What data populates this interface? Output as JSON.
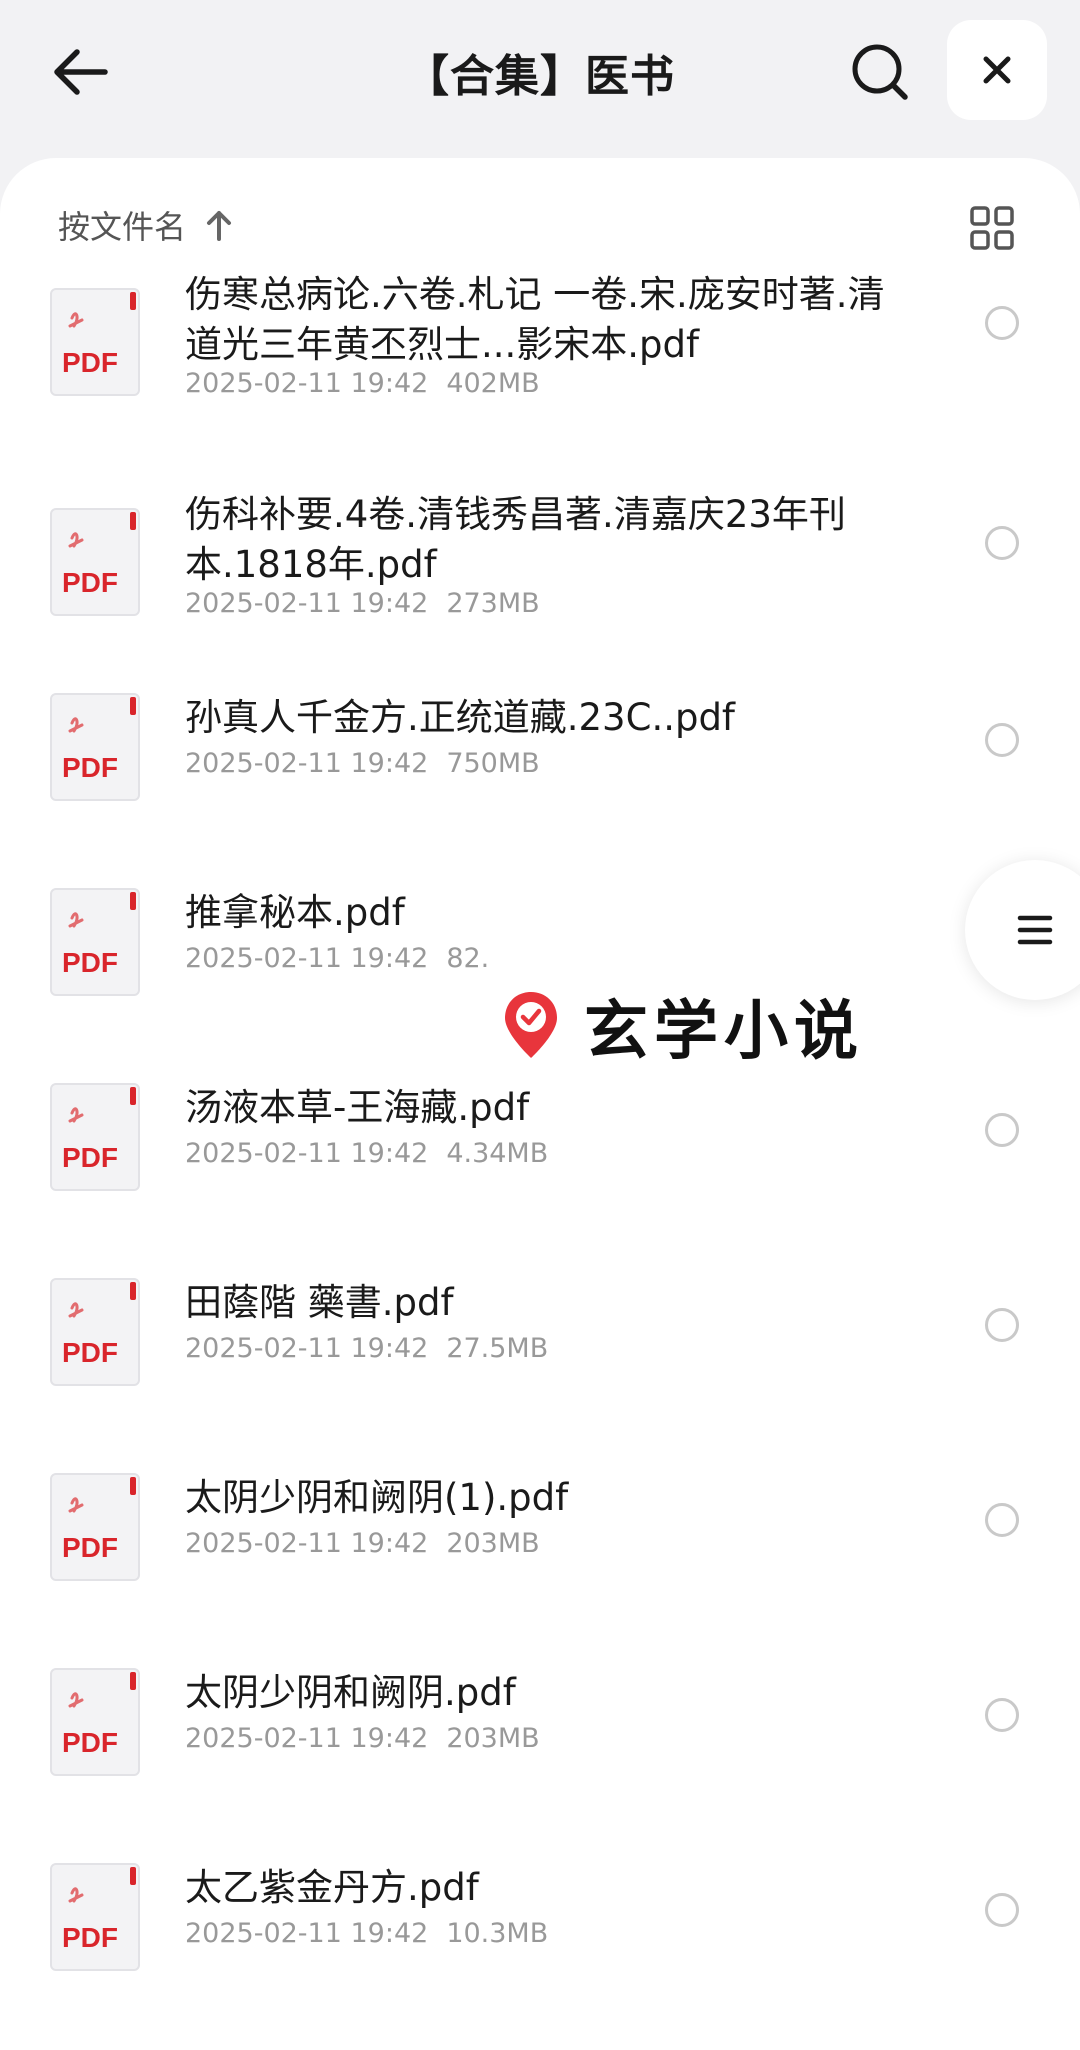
{
  "header": {
    "title": "【合集】医书"
  },
  "sort": {
    "label": "按文件名"
  },
  "files": [
    {
      "name": "伤寒总病论.六卷.札记 一卷.宋.庞安时著.清道光三年黄丕烈士...影宋本.pdf",
      "date": "2025-02-11 19:42",
      "size": "402MB",
      "icon_text": "PDF"
    },
    {
      "name": "伤科补要.4卷.清钱秀昌著.清嘉庆23年刊本.1818年.pdf",
      "date": "2025-02-11 19:42",
      "size": "273MB",
      "icon_text": "PDF"
    },
    {
      "name": "孙真人千金方.正统道藏.23C..pdf",
      "date": "2025-02-11 19:42",
      "size": "750MB",
      "icon_text": "PDF"
    },
    {
      "name": "推拿秘本.pdf",
      "date": "2025-02-11 19:42",
      "size": "82.",
      "icon_text": "PDF"
    },
    {
      "name": "汤液本草-王海藏.pdf",
      "date": "2025-02-11 19:42",
      "size": "4.34MB",
      "icon_text": "PDF"
    },
    {
      "name": "田蔭階 藥書.pdf",
      "date": "2025-02-11 19:42",
      "size": "27.5MB",
      "icon_text": "PDF"
    },
    {
      "name": "太阴少阴和阙阴(1).pdf",
      "date": "2025-02-11 19:42",
      "size": "203MB",
      "icon_text": "PDF"
    },
    {
      "name": "太阴少阴和阙阴.pdf",
      "date": "2025-02-11 19:42",
      "size": "203MB",
      "icon_text": "PDF"
    },
    {
      "name": "太乙紫金丹方.pdf",
      "date": "2025-02-11 19:42",
      "size": "10.3MB",
      "icon_text": "PDF"
    }
  ],
  "watermark": {
    "text": "玄学小说"
  },
  "icons": {
    "back": "arrow-left-icon",
    "search": "search-icon",
    "close": "close-icon",
    "sort": "arrow-up-icon",
    "view": "grid-view-icon",
    "menu": "menu-icon",
    "file": "pdf-file-icon",
    "watermark": "location-pin-check-icon"
  },
  "colors": {
    "pdf_red": "#d9252b",
    "background": "#f2f2f4"
  }
}
